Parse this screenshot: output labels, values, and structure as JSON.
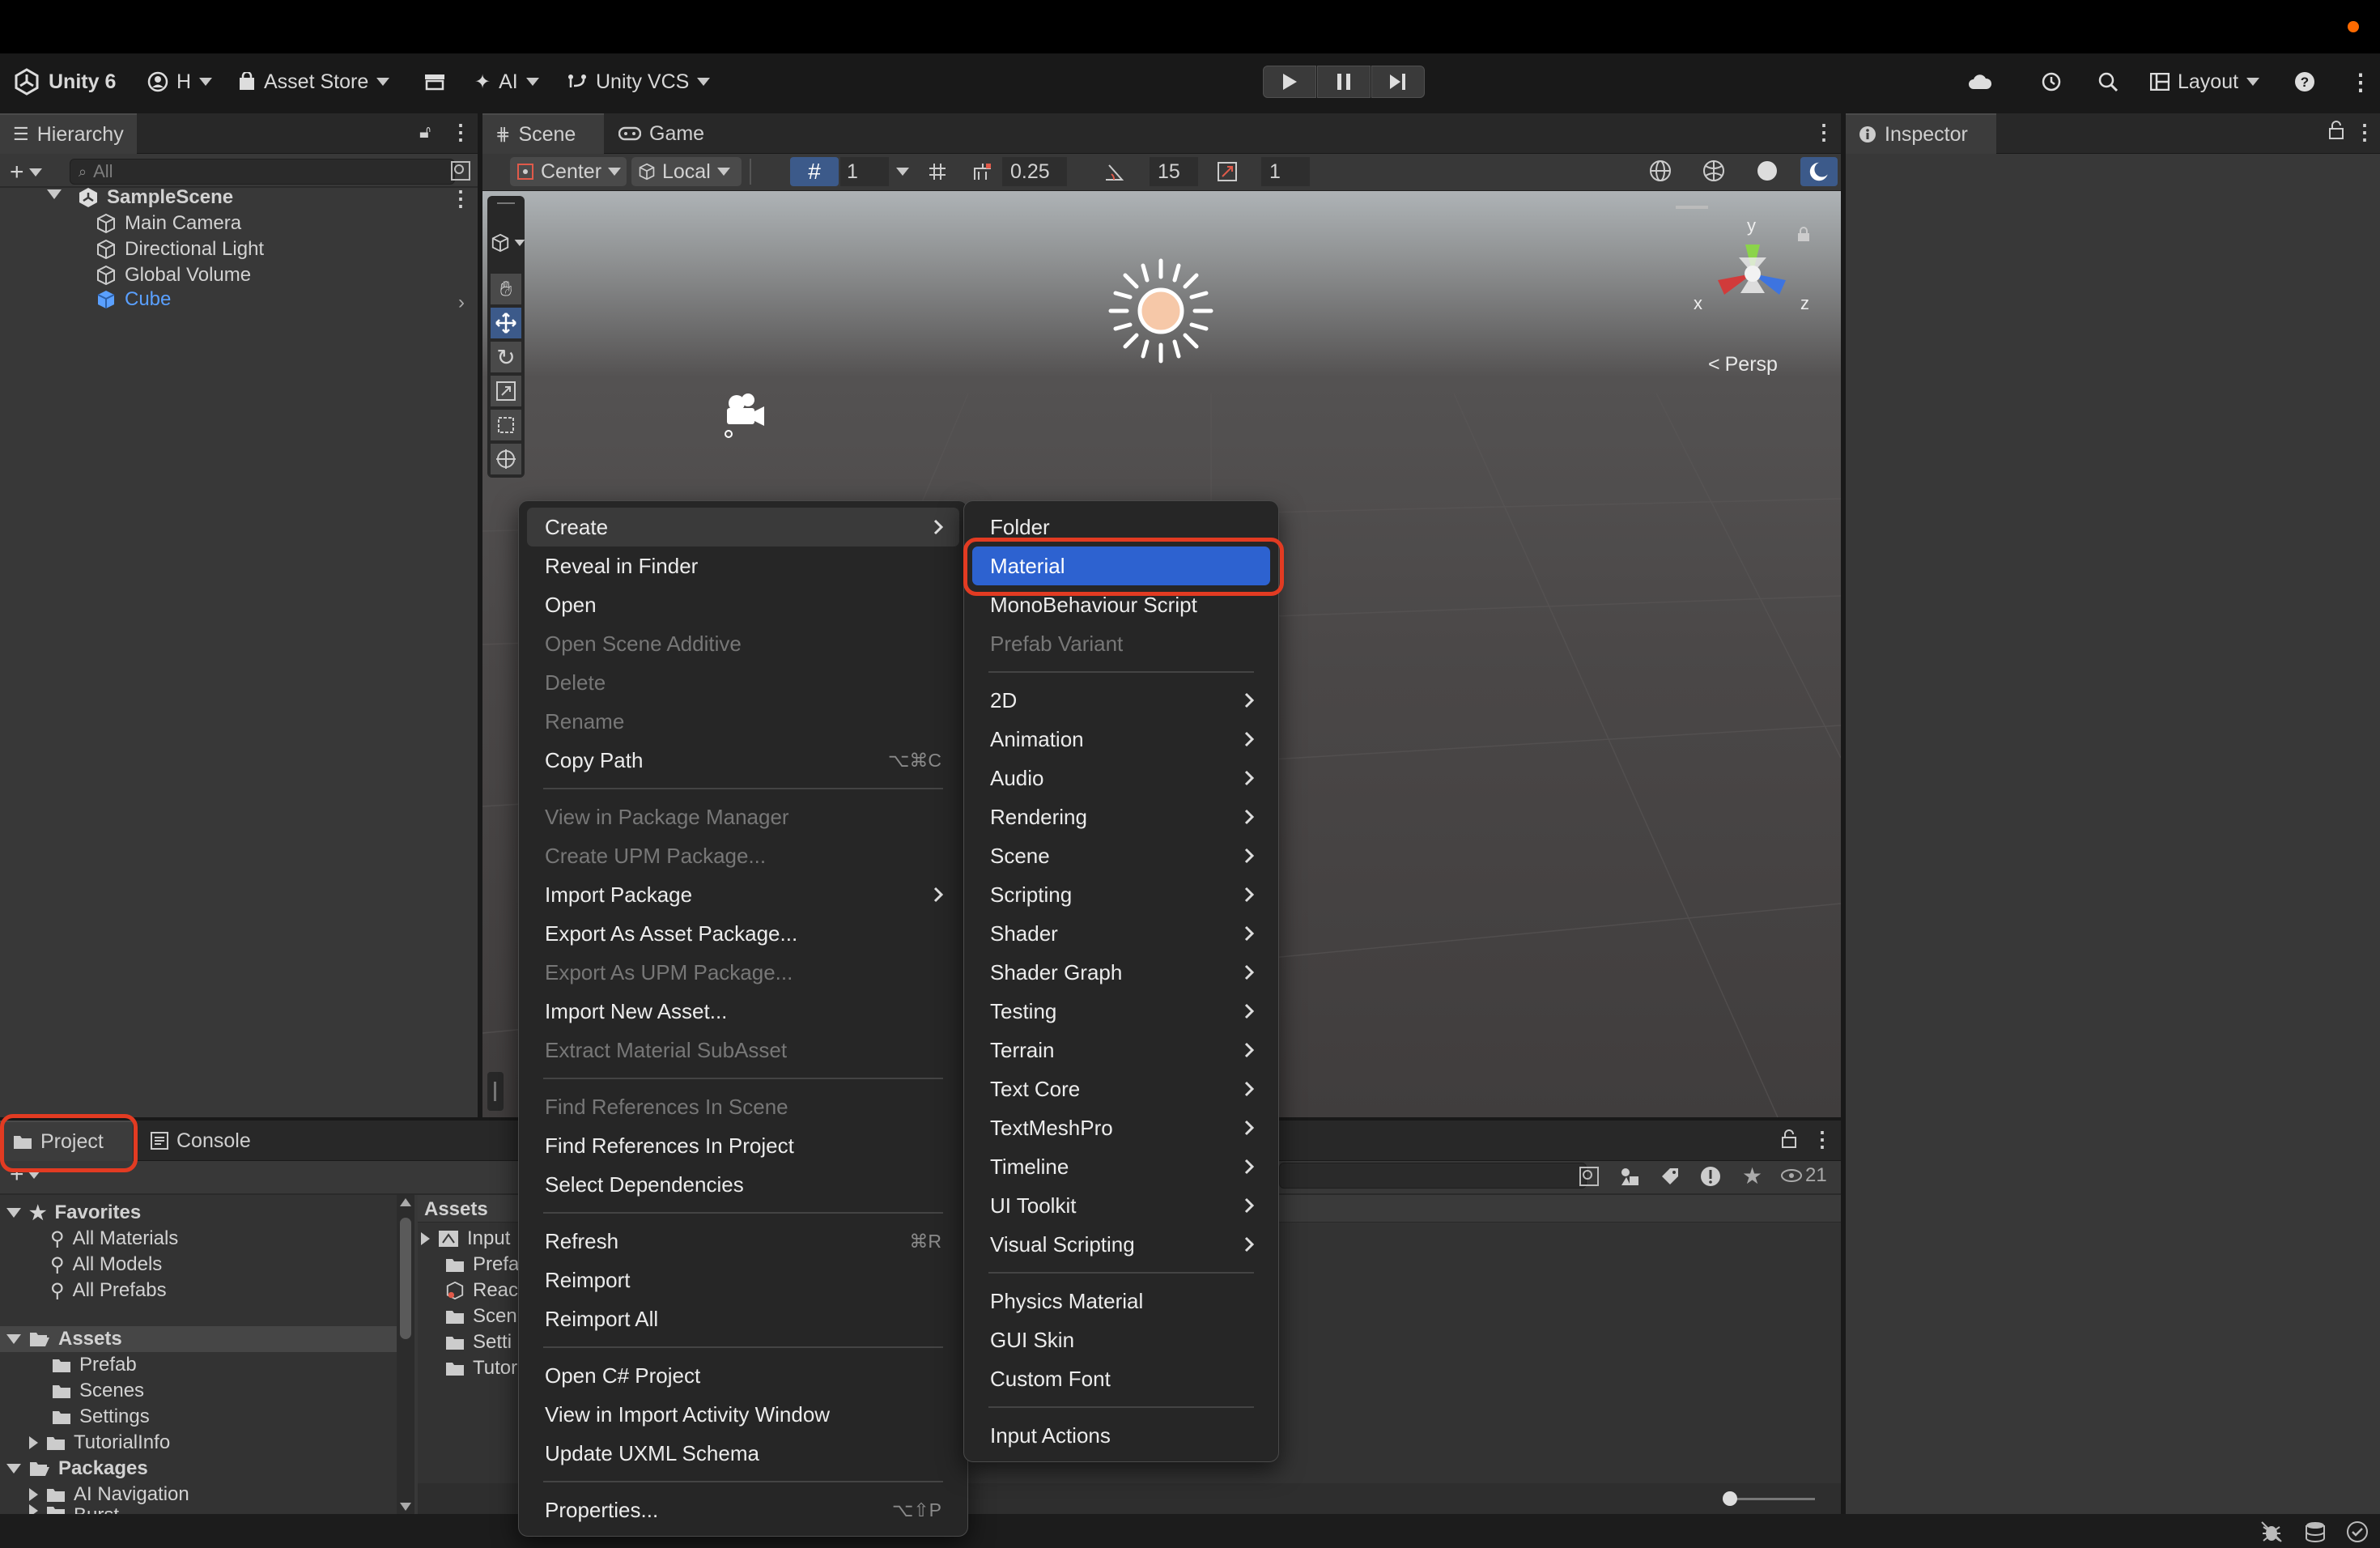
{
  "toolbar": {
    "app_name": "Unity 6",
    "account": "H",
    "asset_store": "Asset Store",
    "ai": "AI",
    "vcs": "Unity VCS",
    "layout": "Layout"
  },
  "hierarchy": {
    "tab": "Hierarchy",
    "search_placeholder": "All",
    "scene": "SampleScene",
    "items": [
      "Main Camera",
      "Directional Light",
      "Global Volume",
      "Cube"
    ]
  },
  "scene_tabs": {
    "scene": "Scene",
    "game": "Game"
  },
  "scene_toolbar": {
    "pivot": "Center",
    "space": "Local",
    "grid_size": "1",
    "snap_increment": "0.25",
    "rotate_snap": "15",
    "scale_snap": "1"
  },
  "gizmo": {
    "y": "y",
    "x": "x",
    "z": "z",
    "persp": "Persp"
  },
  "inspector": {
    "tab": "Inspector"
  },
  "project": {
    "tab_project": "Project",
    "tab_console": "Console",
    "favorites": "Favorites",
    "fav_items": [
      "All Materials",
      "All Models",
      "All Prefabs"
    ],
    "assets": "Assets",
    "asset_folders": [
      "Prefab",
      "Scenes",
      "Settings",
      "TutorialInfo"
    ],
    "packages": "Packages",
    "package_items": [
      "AI Navigation",
      "Burst"
    ],
    "breadcrumb": "Assets",
    "asset_list": [
      "Input",
      "Prefa",
      "Reac",
      "Scen",
      "Setti",
      "Tutor"
    ],
    "hidden_count": "21"
  },
  "context_menu": {
    "items": [
      {
        "label": "Create",
        "submenu": true,
        "state": "highlighted"
      },
      {
        "label": "Reveal in Finder"
      },
      {
        "label": "Open"
      },
      {
        "label": "Open Scene Additive",
        "disabled": true
      },
      {
        "label": "Delete",
        "disabled": true
      },
      {
        "label": "Rename",
        "disabled": true
      },
      {
        "label": "Copy Path",
        "shortcut": "⌥⌘C"
      },
      {
        "label": "View in Package Manager",
        "disabled": true
      },
      {
        "label": "Create UPM Package...",
        "disabled": true
      },
      {
        "label": "Import Package",
        "submenu": true
      },
      {
        "label": "Export As Asset Package..."
      },
      {
        "label": "Export As UPM Package...",
        "disabled": true
      },
      {
        "label": "Import New Asset..."
      },
      {
        "label": "Extract Material SubAsset",
        "disabled": true
      },
      {
        "label": "Find References In Scene",
        "disabled": true
      },
      {
        "label": "Find References In Project"
      },
      {
        "label": "Select Dependencies"
      },
      {
        "label": "Refresh",
        "shortcut": "⌘R"
      },
      {
        "label": "Reimport"
      },
      {
        "label": "Reimport All"
      },
      {
        "label": "Open C# Project"
      },
      {
        "label": "View in Import Activity Window"
      },
      {
        "label": "Update UXML Schema"
      },
      {
        "label": "Properties...",
        "shortcut": "⌥⇧P"
      }
    ]
  },
  "create_submenu": {
    "items": [
      {
        "label": "Folder"
      },
      {
        "label": "Material",
        "state": "selected"
      },
      {
        "label": "MonoBehaviour Script"
      },
      {
        "label": "Prefab Variant",
        "disabled": true
      },
      {
        "label": "2D",
        "submenu": true
      },
      {
        "label": "Animation",
        "submenu": true
      },
      {
        "label": "Audio",
        "submenu": true
      },
      {
        "label": "Rendering",
        "submenu": true
      },
      {
        "label": "Scene",
        "submenu": true
      },
      {
        "label": "Scripting",
        "submenu": true
      },
      {
        "label": "Shader",
        "submenu": true
      },
      {
        "label": "Shader Graph",
        "submenu": true
      },
      {
        "label": "Testing",
        "submenu": true
      },
      {
        "label": "Terrain",
        "submenu": true
      },
      {
        "label": "Text Core",
        "submenu": true
      },
      {
        "label": "TextMeshPro",
        "submenu": true
      },
      {
        "label": "Timeline",
        "submenu": true
      },
      {
        "label": "UI Toolkit",
        "submenu": true
      },
      {
        "label": "Visual Scripting",
        "submenu": true
      },
      {
        "label": "Physics Material"
      },
      {
        "label": "GUI Skin"
      },
      {
        "label": "Custom Font"
      },
      {
        "label": "Input Actions"
      }
    ]
  },
  "colors": {
    "selection": "#2d62d0",
    "annotation": "#e23b22",
    "cube_blue": "#5aa0ff"
  }
}
